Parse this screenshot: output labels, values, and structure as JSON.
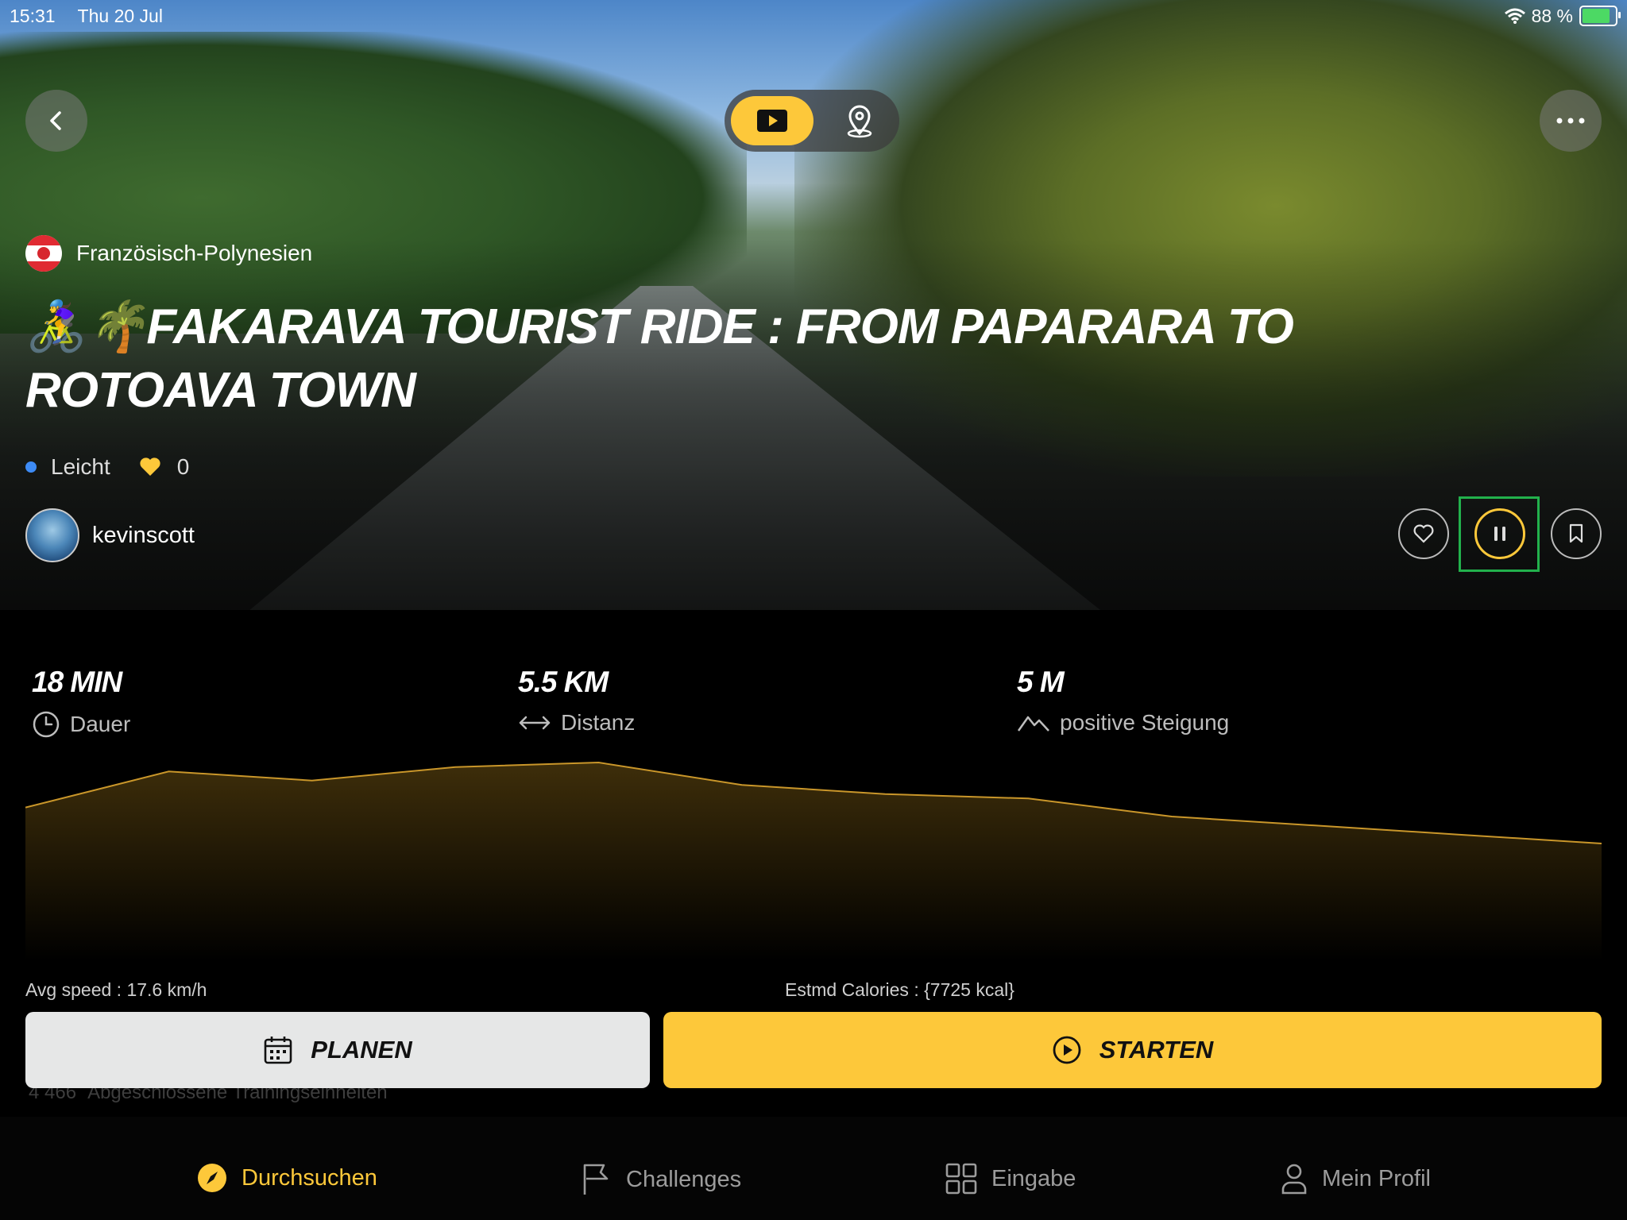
{
  "status_bar": {
    "time": "15:31",
    "date": "Thu 20 Jul",
    "battery": "88 %"
  },
  "header": {
    "toggle_options": [
      "video",
      "map"
    ],
    "active_toggle": "video"
  },
  "ride": {
    "country": "Französisch-Polynesien",
    "title": "🚴‍♀️🌴FAKARAVA TOURIST RIDE : FROM PAPARARA TO ROTOAVA TOWN",
    "difficulty": "Leicht",
    "likes": "0",
    "author": "kevinscott"
  },
  "stats": [
    {
      "value": "18 MIN",
      "label": "Dauer",
      "icon": "clock-icon"
    },
    {
      "value": "5.5 KM",
      "label": "Distanz",
      "icon": "distance-arrows-icon"
    },
    {
      "value": "5 M",
      "label": "positive Steigung",
      "icon": "mountain-icon"
    }
  ],
  "elevation_profile": {
    "type": "area",
    "x": [
      0,
      0.5,
      1.0,
      1.5,
      2.0,
      2.5,
      3.0,
      3.5,
      4.0,
      4.5,
      5.0,
      5.5
    ],
    "values": [
      2.0,
      2.8,
      2.6,
      2.9,
      3.0,
      2.5,
      2.3,
      2.2,
      1.8,
      1.6,
      1.4,
      1.2
    ]
  },
  "info": {
    "avg_speed": "Avg speed : 17.6 km/h",
    "calories": "Estmd Calories : {7725 kcal}"
  },
  "completed": {
    "count": "4 466",
    "label": "Abgeschlossene Trainingseinheiten"
  },
  "buttons": {
    "plan": "PLANEN",
    "start": "STARTEN"
  },
  "tabs": [
    {
      "label": "Durchsuchen",
      "icon": "compass-icon",
      "active": true
    },
    {
      "label": "Challenges",
      "icon": "flag-icon",
      "active": false
    },
    {
      "label": "Eingabe",
      "icon": "grid-icon",
      "active": false
    },
    {
      "label": "Mein Profil",
      "icon": "person-icon",
      "active": false
    }
  ],
  "colors": {
    "accent": "#fdc83a",
    "background": "#000000",
    "difficulty_dot": "#3d8bf5",
    "highlight": "#22b14c"
  }
}
